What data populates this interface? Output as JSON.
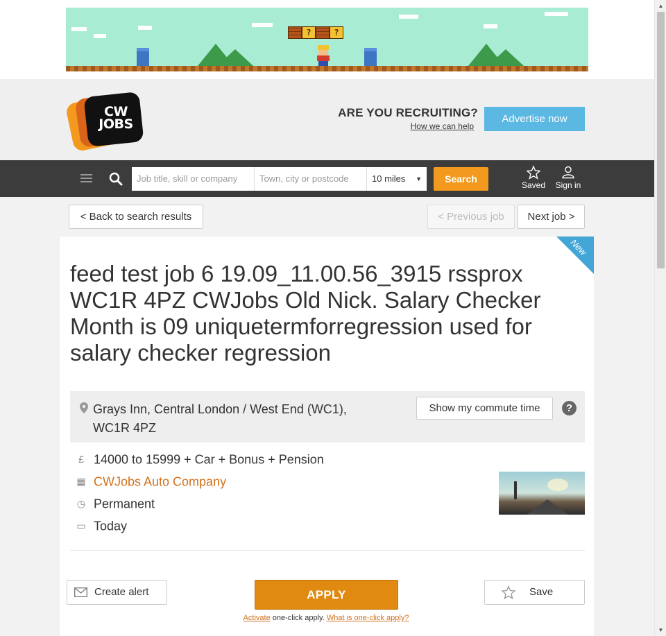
{
  "header": {
    "logo_text_line1": "CW",
    "logo_text_line2": "JOBS",
    "recruit_title": "ARE YOU RECRUITING?",
    "recruit_link": "How we can help",
    "advertise_label": "Advertise now"
  },
  "nav": {
    "job_placeholder": "Job title, skill or company",
    "town_placeholder": "Town, city or postcode",
    "distance_selected": "10 miles",
    "search_label": "Search",
    "saved_label": "Saved",
    "signin_label": "Sign in"
  },
  "pager": {
    "back_label": "< Back to search results",
    "prev_label": "< Previous job",
    "next_label": "Next job >"
  },
  "job": {
    "badge": "New",
    "title": "feed test job 6 19.09_11.00.56_3915 rssprox WC1R 4PZ CWJobs Old Nick. Salary Checker Month is 09 uniquetermforregression used for salary checker regression",
    "location": "Grays Inn, Central London / West End (WC1), WC1R 4PZ",
    "commute_label": "Show my commute time",
    "help_symbol": "?",
    "salary": "14000 to 15999 + Car + Bonus + Pension",
    "company": "CWJobs Auto Company",
    "job_type": "Permanent",
    "posted": "Today"
  },
  "icons": {
    "salary": "pound-icon",
    "company": "building-icon",
    "job_type": "clock-icon",
    "posted": "calendar-icon"
  },
  "colors": {
    "accent_orange": "#f39a1e",
    "advertise_blue": "#5bb8e2",
    "nav_dark": "#3c3c3c",
    "company_link": "#d2711c",
    "ribbon_blue": "#43a6d6"
  },
  "ad": {
    "block_symbol": "?"
  }
}
